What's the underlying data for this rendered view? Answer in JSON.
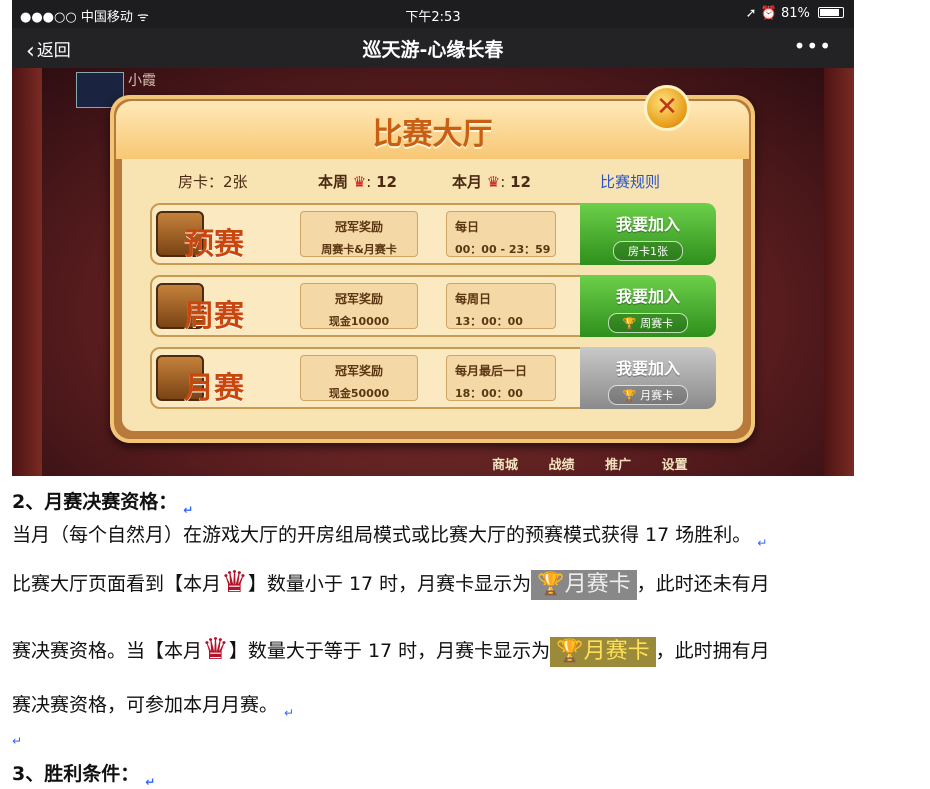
{
  "status_bar": {
    "carrier": "●●●○○ 中国移动 ᯤ",
    "time": "下午2:53",
    "battery": "81%",
    "icons": "➚ ⏰"
  },
  "nav": {
    "back_label": "返回",
    "title": "巡天游-心缘长春",
    "more_label": "•••"
  },
  "game": {
    "player_name": "小霞",
    "bottom_menu": [
      "商城",
      "战绩",
      "推广",
      "设置"
    ],
    "dialog": {
      "title": "比赛大厅",
      "close_label": "✕",
      "room_cards": "房卡：2张",
      "week_label": "本周",
      "week_count": "12",
      "month_label": "本月",
      "month_count": "12",
      "rules_label": "比赛规则",
      "rows": [
        {
          "name": "预赛",
          "reward_title": "冠军奖励",
          "reward_text": "周赛卡&月赛卡",
          "time_label": "每日",
          "time_value": "00：00 - 23：59",
          "join_label": "我要加入",
          "join_cost": "房卡1张",
          "state": "green"
        },
        {
          "name": "周赛",
          "reward_title": "冠军奖励",
          "reward_text": "现金10000",
          "time_label": "每周日",
          "time_value": "13：00：00",
          "join_label": "我要加入",
          "join_cost": "周赛卡",
          "state": "green"
        },
        {
          "name": "月赛",
          "reward_title": "冠军奖励",
          "reward_text": "现金50000",
          "time_label": "每月最后一日",
          "time_value": "18：00：00",
          "join_label": "我要加入",
          "join_cost": "月赛卡",
          "state": "gray"
        }
      ]
    }
  },
  "doc": {
    "heading2": "2、月赛决赛资格：",
    "p1": "当月（每个自然月）在游戏大厅的开房组局模式或比赛大厅的预赛模式获得 17 场胜利。",
    "p2a": "比赛大厅页面看到【本月",
    "p2b": "】数量小于 17 时，月赛卡显示为",
    "chip_label": "月赛卡",
    "p2c": "，此时还未有月",
    "p3a": "赛决赛资格。当【本月",
    "p3b": "】数量大于等于 17 时，月赛卡显示为",
    "p3c": "，此时拥有月",
    "p4": "赛决赛资格，可参加本月月赛。",
    "heading3": "3、胜利条件："
  }
}
